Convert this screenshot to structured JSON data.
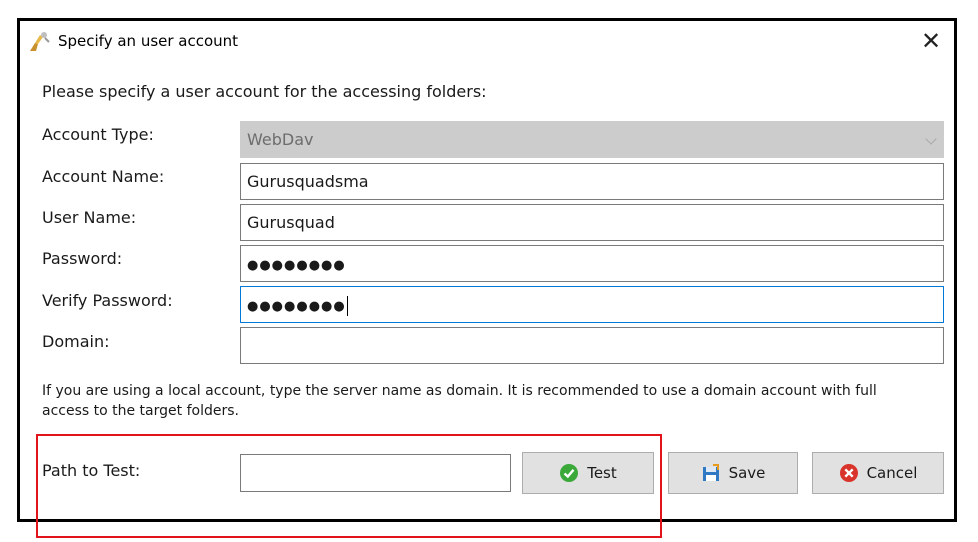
{
  "window": {
    "title": "Specify an user account",
    "close_symbol": "✕"
  },
  "intro": "Please specify a user account for the accessing folders:",
  "fields": {
    "account_type": {
      "label": "Account Type:",
      "value": "WebDav"
    },
    "account_name": {
      "label": "Account Name:",
      "value": "Gurusquadsma"
    },
    "user_name": {
      "label": "User Name:",
      "value": "Gurusquad"
    },
    "password": {
      "label": "Password:",
      "value": "●●●●●●●●"
    },
    "verify_password": {
      "label": "Verify Password:",
      "value": "●●●●●●●●"
    },
    "domain": {
      "label": "Domain:",
      "value": ""
    }
  },
  "note": "If you are using a local account, type the server name as domain. It is recommended to use a domain account with full access to the target folders.",
  "path_test": {
    "label": "Path to Test:",
    "value": ""
  },
  "buttons": {
    "test": "Test",
    "save": "Save",
    "cancel": "Cancel"
  },
  "icons": {
    "app": "key-hand-icon",
    "test": "green-check-icon",
    "save": "save-icon",
    "cancel": "red-x-icon"
  },
  "colors": {
    "highlight": "#e3131b",
    "focus_border": "#0078d7",
    "disabled_fill": "#cccccc"
  }
}
